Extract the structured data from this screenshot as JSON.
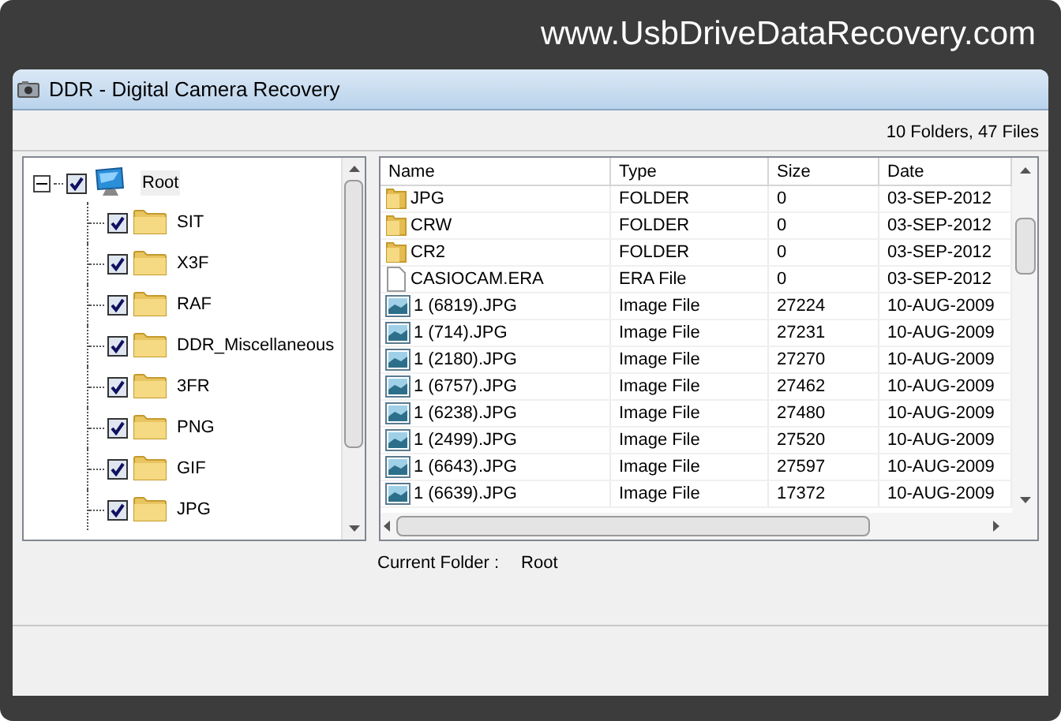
{
  "banner": {
    "text": "www.UsbDriveDataRecovery.com"
  },
  "window": {
    "title": "DDR - Digital Camera Recovery"
  },
  "summary": "10 Folders, 47 Files",
  "tree": [
    {
      "label": "Root",
      "kind": "drive",
      "checked": true,
      "expanded": true,
      "children": [
        {
          "label": "SIT",
          "kind": "folder",
          "checked": true
        },
        {
          "label": "X3F",
          "kind": "folder",
          "checked": true
        },
        {
          "label": "RAF",
          "kind": "folder",
          "checked": true
        },
        {
          "label": "DDR_Miscellaneous",
          "kind": "folder",
          "checked": true
        },
        {
          "label": "3FR",
          "kind": "folder",
          "checked": true
        },
        {
          "label": "PNG",
          "kind": "folder",
          "checked": true
        },
        {
          "label": "GIF",
          "kind": "folder",
          "checked": true
        },
        {
          "label": "JPG",
          "kind": "folder",
          "checked": true
        }
      ]
    }
  ],
  "table": {
    "columns": [
      "Name",
      "Type",
      "Size",
      "Date"
    ],
    "rows": [
      {
        "kind": "folder",
        "cells": [
          "JPG",
          "FOLDER",
          "0",
          "03-SEP-2012"
        ]
      },
      {
        "kind": "folder",
        "cells": [
          "CRW",
          "FOLDER",
          "0",
          "03-SEP-2012"
        ]
      },
      {
        "kind": "folder",
        "cells": [
          "CR2",
          "FOLDER",
          "0",
          "03-SEP-2012"
        ]
      },
      {
        "kind": "file",
        "cells": [
          "CASIOCAM.ERA",
          "ERA File",
          "0",
          "03-SEP-2012"
        ]
      },
      {
        "kind": "image",
        "cells": [
          "1 (6819).JPG",
          "Image File",
          "27224",
          "10-AUG-2009"
        ]
      },
      {
        "kind": "image",
        "cells": [
          "1 (714).JPG",
          "Image File",
          "27231",
          "10-AUG-2009"
        ]
      },
      {
        "kind": "image",
        "cells": [
          "1 (2180).JPG",
          "Image File",
          "27270",
          "10-AUG-2009"
        ]
      },
      {
        "kind": "image",
        "cells": [
          "1 (6757).JPG",
          "Image File",
          "27462",
          "10-AUG-2009"
        ]
      },
      {
        "kind": "image",
        "cells": [
          "1 (6238).JPG",
          "Image File",
          "27480",
          "10-AUG-2009"
        ]
      },
      {
        "kind": "image",
        "cells": [
          "1 (2499).JPG",
          "Image File",
          "27520",
          "10-AUG-2009"
        ]
      },
      {
        "kind": "image",
        "cells": [
          "1 (6643).JPG",
          "Image File",
          "27597",
          "10-AUG-2009"
        ]
      },
      {
        "kind": "image",
        "cells": [
          "1 (6639).JPG",
          "Image File",
          "17372",
          "10-AUG-2009"
        ]
      }
    ]
  },
  "current_folder": {
    "label": "Current Folder :",
    "value": "Root"
  }
}
